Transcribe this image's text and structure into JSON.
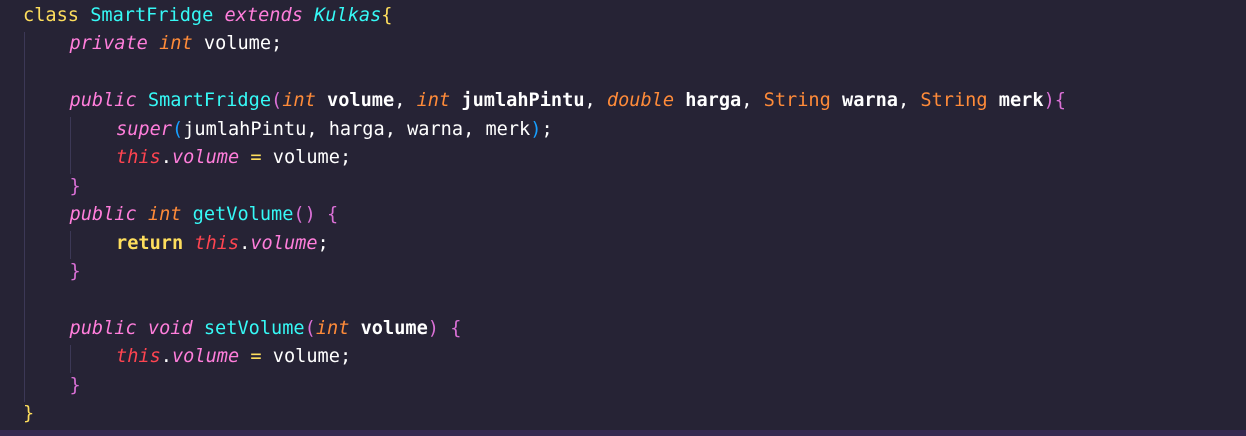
{
  "editor": {
    "language": "Java",
    "theme_colors": {
      "background": "#262335",
      "keyword": "#fede5d",
      "modifier": "#ff7edb",
      "class_name": "#36f9f6",
      "type": "#fe4450",
      "string_type": "#ff8b39",
      "identifier": "#ffffff",
      "bracket_level_1": "#fede5d",
      "bracket_level_2": "#da70d6",
      "bracket_level_3": "#179fff"
    },
    "lines": [
      {
        "tokens": [
          {
            "t": "class",
            "c": "t-kw"
          },
          {
            "t": " ",
            "c": "t-punc"
          },
          {
            "t": "SmartFridge",
            "c": "t-cls"
          },
          {
            "t": " ",
            "c": "t-punc"
          },
          {
            "t": "extends",
            "c": "t-mod"
          },
          {
            "t": " ",
            "c": "t-punc"
          },
          {
            "t": "Kulkas",
            "c": "t-clsi"
          },
          {
            "t": "{",
            "c": "t-b1"
          }
        ]
      },
      {
        "tokens": [
          {
            "t": "private",
            "c": "t-mod"
          },
          {
            "t": " ",
            "c": "t-punc"
          },
          {
            "t": "int",
            "c": "t-typeN"
          },
          {
            "t": " ",
            "c": "t-punc"
          },
          {
            "t": "volume",
            "c": "t-var"
          },
          {
            "t": ";",
            "c": "t-punc"
          }
        ]
      },
      {
        "tokens": []
      },
      {
        "tokens": [
          {
            "t": "public",
            "c": "t-mod"
          },
          {
            "t": " ",
            "c": "t-punc"
          },
          {
            "t": "SmartFridge",
            "c": "t-cls"
          },
          {
            "t": "(",
            "c": "t-b2"
          },
          {
            "t": "int",
            "c": "t-typeN"
          },
          {
            "t": " ",
            "c": "t-punc"
          },
          {
            "t": "volume",
            "c": "t-param"
          },
          {
            "t": ", ",
            "c": "t-punc"
          },
          {
            "t": "int",
            "c": "t-typeN"
          },
          {
            "t": " ",
            "c": "t-punc"
          },
          {
            "t": "jumlahPintu",
            "c": "t-param"
          },
          {
            "t": ", ",
            "c": "t-punc"
          },
          {
            "t": "double",
            "c": "t-typeN"
          },
          {
            "t": " ",
            "c": "t-punc"
          },
          {
            "t": "harga",
            "c": "t-param"
          },
          {
            "t": ", ",
            "c": "t-punc"
          },
          {
            "t": "String",
            "c": "t-str"
          },
          {
            "t": " ",
            "c": "t-punc"
          },
          {
            "t": "warna",
            "c": "t-param"
          },
          {
            "t": ", ",
            "c": "t-punc"
          },
          {
            "t": "String",
            "c": "t-str"
          },
          {
            "t": " ",
            "c": "t-punc"
          },
          {
            "t": "merk",
            "c": "t-param"
          },
          {
            "t": ")",
            "c": "t-b2"
          },
          {
            "t": "{",
            "c": "t-b2"
          }
        ]
      },
      {
        "tokens": [
          {
            "t": "super",
            "c": "t-mod"
          },
          {
            "t": "(",
            "c": "t-b3"
          },
          {
            "t": "jumlahPintu",
            "c": "t-var"
          },
          {
            "t": ", ",
            "c": "t-punc"
          },
          {
            "t": "harga",
            "c": "t-var"
          },
          {
            "t": ", ",
            "c": "t-punc"
          },
          {
            "t": "warna",
            "c": "t-var"
          },
          {
            "t": ", ",
            "c": "t-punc"
          },
          {
            "t": "merk",
            "c": "t-var"
          },
          {
            "t": ")",
            "c": "t-b3"
          },
          {
            "t": ";",
            "c": "t-punc"
          }
        ]
      },
      {
        "tokens": [
          {
            "t": "this",
            "c": "t-this"
          },
          {
            "t": ".",
            "c": "t-punc"
          },
          {
            "t": "volume",
            "c": "t-prop"
          },
          {
            "t": " ",
            "c": "t-punc"
          },
          {
            "t": "=",
            "c": "t-op"
          },
          {
            "t": " ",
            "c": "t-punc"
          },
          {
            "t": "volume",
            "c": "t-var"
          },
          {
            "t": ";",
            "c": "t-punc"
          }
        ]
      },
      {
        "tokens": [
          {
            "t": "}",
            "c": "t-b2"
          }
        ]
      },
      {
        "tokens": [
          {
            "t": "public",
            "c": "t-mod"
          },
          {
            "t": " ",
            "c": "t-punc"
          },
          {
            "t": "int",
            "c": "t-typeN"
          },
          {
            "t": " ",
            "c": "t-punc"
          },
          {
            "t": "getVolume",
            "c": "t-fn"
          },
          {
            "t": "()",
            "c": "t-b2"
          },
          {
            "t": " ",
            "c": "t-punc"
          },
          {
            "t": "{",
            "c": "t-b2"
          }
        ]
      },
      {
        "tokens": [
          {
            "t": "return",
            "c": "t-ret"
          },
          {
            "t": " ",
            "c": "t-punc"
          },
          {
            "t": "this",
            "c": "t-this"
          },
          {
            "t": ".",
            "c": "t-punc"
          },
          {
            "t": "volume",
            "c": "t-prop"
          },
          {
            "t": ";",
            "c": "t-punc"
          }
        ]
      },
      {
        "tokens": [
          {
            "t": "}",
            "c": "t-b2"
          }
        ]
      },
      {
        "tokens": []
      },
      {
        "tokens": [
          {
            "t": "public",
            "c": "t-mod"
          },
          {
            "t": " ",
            "c": "t-punc"
          },
          {
            "t": "void",
            "c": "t-mod"
          },
          {
            "t": " ",
            "c": "t-punc"
          },
          {
            "t": "setVolume",
            "c": "t-fn"
          },
          {
            "t": "(",
            "c": "t-b2"
          },
          {
            "t": "int",
            "c": "t-typeN"
          },
          {
            "t": " ",
            "c": "t-punc"
          },
          {
            "t": "volume",
            "c": "t-param"
          },
          {
            "t": ")",
            "c": "t-b2"
          },
          {
            "t": " ",
            "c": "t-punc"
          },
          {
            "t": "{",
            "c": "t-b2"
          }
        ]
      },
      {
        "tokens": [
          {
            "t": "this",
            "c": "t-this"
          },
          {
            "t": ".",
            "c": "t-punc"
          },
          {
            "t": "volume",
            "c": "t-prop"
          },
          {
            "t": " ",
            "c": "t-punc"
          },
          {
            "t": "=",
            "c": "t-op"
          },
          {
            "t": " ",
            "c": "t-punc"
          },
          {
            "t": "volume",
            "c": "t-var"
          },
          {
            "t": ";",
            "c": "t-punc"
          }
        ]
      },
      {
        "tokens": [
          {
            "t": "}",
            "c": "t-b2"
          }
        ]
      },
      {
        "tokens": [
          {
            "t": "}",
            "c": "t-b1"
          }
        ]
      }
    ]
  }
}
